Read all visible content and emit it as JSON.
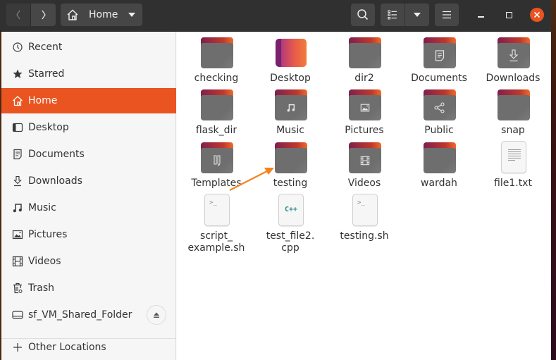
{
  "header": {
    "path_label": "Home",
    "back_icon": "chevron-left-icon",
    "forward_icon": "chevron-right-icon",
    "search_icon": "search-icon",
    "view_icon": "list-view-icon",
    "menu_icon": "hamburger-menu-icon"
  },
  "sidebar": {
    "items": [
      {
        "label": "Recent",
        "icon": "clock-icon"
      },
      {
        "label": "Starred",
        "icon": "star-icon"
      },
      {
        "label": "Home",
        "icon": "home-icon",
        "active": true
      },
      {
        "label": "Desktop",
        "icon": "desktop-icon"
      },
      {
        "label": "Documents",
        "icon": "document-icon"
      },
      {
        "label": "Downloads",
        "icon": "download-icon"
      },
      {
        "label": "Music",
        "icon": "music-icon"
      },
      {
        "label": "Pictures",
        "icon": "picture-icon"
      },
      {
        "label": "Videos",
        "icon": "film-icon"
      },
      {
        "label": "Trash",
        "icon": "trash-icon"
      },
      {
        "label": "sf_VM_Shared_Folder",
        "icon": "drive-icon"
      }
    ],
    "other_locations": "Other Locations"
  },
  "files": [
    {
      "name": "checking",
      "type": "folder"
    },
    {
      "name": "Desktop",
      "type": "desktop"
    },
    {
      "name": "dir2",
      "type": "folder"
    },
    {
      "name": "Documents",
      "type": "folder",
      "emblem": "document"
    },
    {
      "name": "Downloads",
      "type": "folder",
      "emblem": "download"
    },
    {
      "name": "flask_dir",
      "type": "folder"
    },
    {
      "name": "Music",
      "type": "folder",
      "emblem": "music"
    },
    {
      "name": "Pictures",
      "type": "folder",
      "emblem": "picture"
    },
    {
      "name": "Public",
      "type": "folder",
      "emblem": "share"
    },
    {
      "name": "snap",
      "type": "folder"
    },
    {
      "name": "Templates",
      "type": "folder",
      "emblem": "template"
    },
    {
      "name": "testing",
      "type": "folder"
    },
    {
      "name": "Videos",
      "type": "folder",
      "emblem": "film"
    },
    {
      "name": "wardah",
      "type": "folder"
    },
    {
      "name": "file1.txt",
      "type": "text"
    },
    {
      "name": "script_ example.sh",
      "line1": "script_",
      "line2": "example.sh",
      "type": "script"
    },
    {
      "name": "test_file2. cpp",
      "line1": "test_file2.",
      "line2": "cpp",
      "type": "cpp"
    },
    {
      "name": "testing.sh",
      "type": "script"
    }
  ],
  "glyphs": {
    "terminal": ">_",
    "cpp": "C++"
  },
  "colors": {
    "accent": "#e95420",
    "arrow": "#f7821b"
  }
}
